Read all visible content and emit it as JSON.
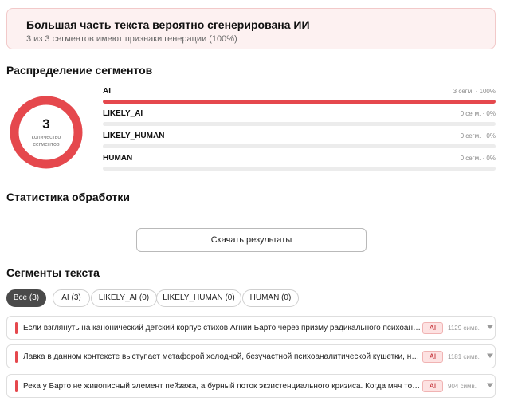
{
  "banner": {
    "title": "Большая часть текста вероятно сгенерирована ИИ",
    "subtitle": "3 из 3 сегментов имеют признаки генерации (100%)"
  },
  "distribution": {
    "title": "Распределение сегментов",
    "total": "3",
    "total_label": "количество сегментов",
    "accent": "#e5484d",
    "rows": [
      {
        "name": "AI",
        "value": "3 сегм. · 100%",
        "fraction": 1.0
      },
      {
        "name": "LIKELY_AI",
        "value": "0 сегм. · 0%",
        "fraction": 0
      },
      {
        "name": "LIKELY_HUMAN",
        "value": "0 сегм. · 0%",
        "fraction": 0
      },
      {
        "name": "HUMAN",
        "value": "0 сегм. · 0%",
        "fraction": 0
      }
    ]
  },
  "stats": {
    "title": "Статистика обработки"
  },
  "download": {
    "label": "Скачать результаты"
  },
  "segments": {
    "title": "Сегменты текста",
    "filters": [
      {
        "label": "Все (3)",
        "active": true
      },
      {
        "label": "AI (3)",
        "active": false
      },
      {
        "label": "LIKELY_AI (0)",
        "active": false
      },
      {
        "label": "LIKELY_HUMAN (0)",
        "active": false
      },
      {
        "label": "HUMAN (0)",
        "active": false
      }
    ],
    "items": [
      {
        "text": "Если взглянуть на канонический детский корпус стихов Агнии Барто через призму радикального психоанализа",
        "badge": "AI",
        "chars": "1129 симв.",
        "icon": "chevron-down-icon"
      },
      {
        "text": "Лавка в данном контексте выступает метафорой холодной, безучастной психоаналитической кушетки, на которой",
        "badge": "AI",
        "chars": "1181 симв.",
        "icon": "chevron-down-icon"
      },
      {
        "text": "Река у Барто не живописный элемент пейзажа, а бурный поток экзистенциального кризиса. Когда мяч тонет",
        "badge": "AI",
        "chars": "904 симв.",
        "icon": "chevron-down-icon"
      }
    ]
  }
}
